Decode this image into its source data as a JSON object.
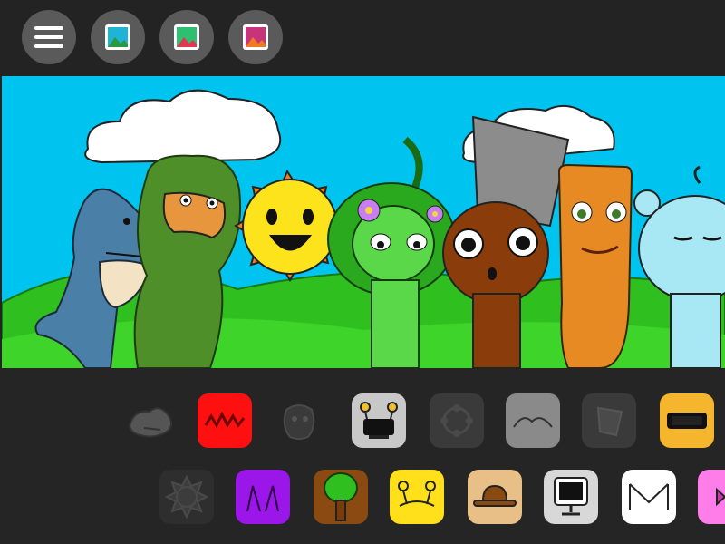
{
  "toolbar": {
    "buttons": [
      {
        "icon": "menu-icon"
      },
      {
        "icon": "image-blue-icon",
        "accent": "#1fb3d6"
      },
      {
        "icon": "image-green-icon",
        "accent": "#2fbf71"
      },
      {
        "icon": "image-red-icon",
        "accent": "#d03a52"
      }
    ]
  },
  "stage": {
    "sky": "#00c4f0",
    "hill": "#2fbf1f",
    "characters": [
      {
        "icon": "shark-character"
      },
      {
        "icon": "bigfoot-character"
      },
      {
        "icon": "sun-character"
      },
      {
        "icon": "leaf-girl-character"
      },
      {
        "icon": "bucket-head-character"
      },
      {
        "icon": "wooden-totem-character"
      },
      {
        "icon": "blue-bear-character"
      }
    ]
  },
  "palette": {
    "row1": [
      {
        "icon": "shark-face-icon",
        "state": "used"
      },
      {
        "icon": "red-spikes-icon",
        "state": "available",
        "color": "#ff1010"
      },
      {
        "icon": "bigfoot-face-icon",
        "state": "used"
      },
      {
        "icon": "speaker-box-icon",
        "state": "available",
        "color": "#c8c8c8"
      },
      {
        "icon": "flower-wreath-icon",
        "state": "used"
      },
      {
        "icon": "grey-ears-icon",
        "state": "available",
        "color": "#8a8a8a"
      },
      {
        "icon": "bucket-hat-icon",
        "state": "used"
      },
      {
        "icon": "orange-visor-icon",
        "state": "available",
        "color": "#f5b52c"
      }
    ],
    "row2": [
      {
        "icon": "sun-outline-icon",
        "state": "used"
      },
      {
        "icon": "purple-horns-icon",
        "state": "available",
        "color": "#9b16e8"
      },
      {
        "icon": "tree-icon",
        "state": "available",
        "color": "#8a4a12"
      },
      {
        "icon": "yellow-antennae-icon",
        "state": "available",
        "color": "#ffe01a"
      },
      {
        "icon": "brown-hat-icon",
        "state": "available",
        "color": "#e8bf86"
      },
      {
        "icon": "computer-icon",
        "state": "available",
        "color": "#d8d8d8"
      },
      {
        "icon": "white-envelope-icon",
        "state": "available",
        "color": "#ffffff"
      },
      {
        "icon": "pink-bow-icon",
        "state": "available",
        "color": "#ff7de8"
      }
    ]
  }
}
